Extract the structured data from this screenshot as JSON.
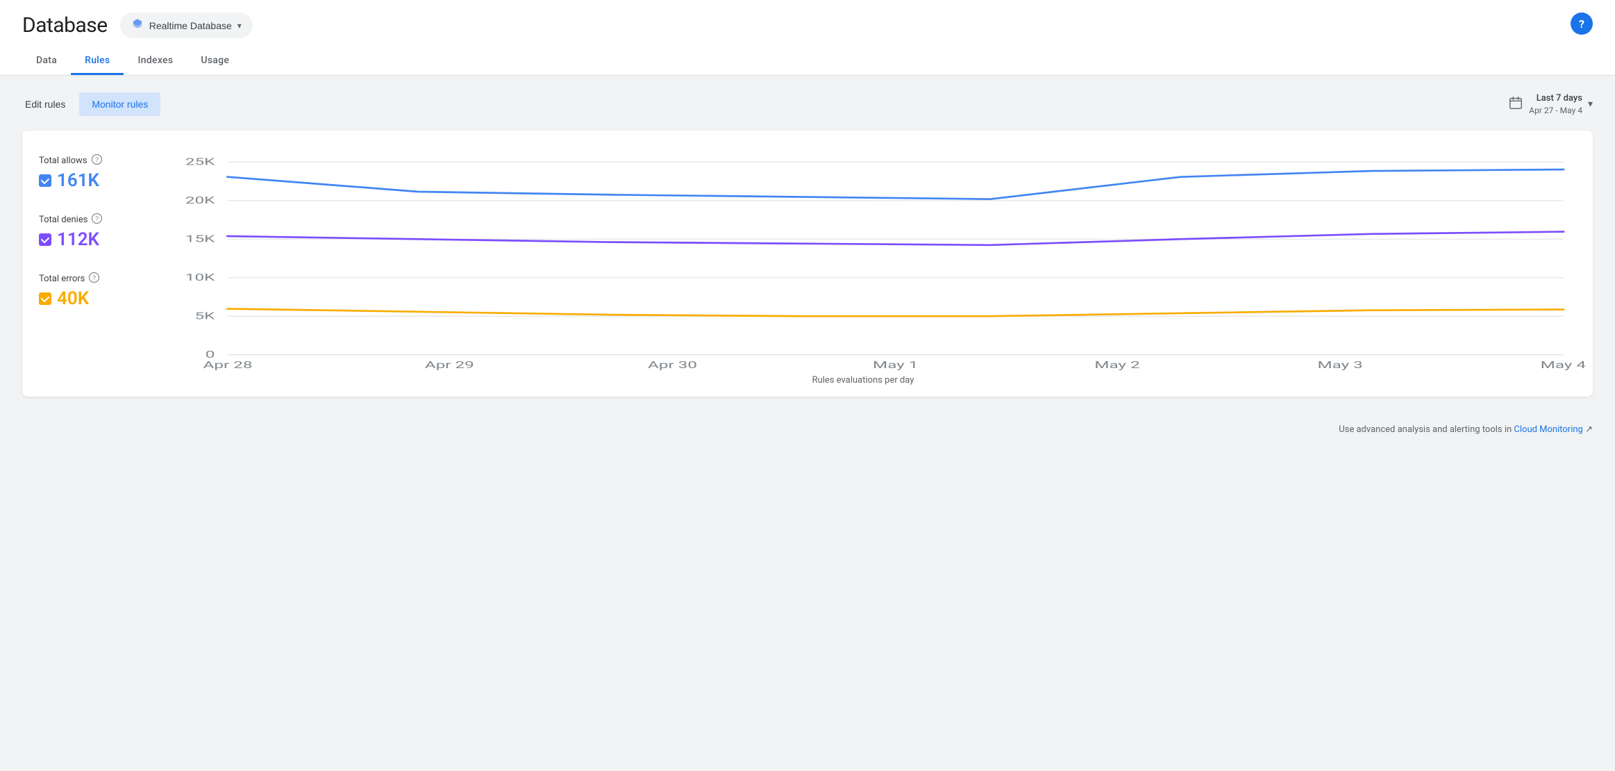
{
  "header": {
    "title": "Database",
    "db_selector_label": "Realtime Database",
    "help_label": "?"
  },
  "nav": {
    "tabs": [
      {
        "id": "data",
        "label": "Data",
        "active": false
      },
      {
        "id": "rules",
        "label": "Rules",
        "active": true
      },
      {
        "id": "indexes",
        "label": "Indexes",
        "active": false
      },
      {
        "id": "usage",
        "label": "Usage",
        "active": false
      }
    ]
  },
  "toolbar": {
    "edit_rules_label": "Edit rules",
    "monitor_rules_label": "Monitor rules",
    "date_period_label": "Last 7 days",
    "date_range_label": "Apr 27 - May 4"
  },
  "chart": {
    "title": "Rules evaluations per day",
    "y_labels": [
      "0",
      "5K",
      "10K",
      "15K",
      "20K",
      "25K"
    ],
    "x_labels": [
      "Apr 28",
      "Apr 29",
      "Apr 30",
      "May 1",
      "May 2",
      "May 3",
      "May 4"
    ],
    "series": [
      {
        "id": "allows",
        "label": "Total allows",
        "value": "161K",
        "color": "#4285f4",
        "checkbox_color": "#4285f4",
        "points": [
          24000,
          22000,
          21500,
          21200,
          21000,
          24000,
          24800,
          25000
        ]
      },
      {
        "id": "denies",
        "label": "Total denies",
        "value": "112K",
        "color": "#7c4dff",
        "checkbox_color": "#7c4dff",
        "points": [
          16000,
          15500,
          15200,
          15000,
          14800,
          15500,
          16200,
          16500
        ]
      },
      {
        "id": "errors",
        "label": "Total errors",
        "value": "40K",
        "color": "#f9ab00",
        "checkbox_color": "#f9ab00",
        "points": [
          6200,
          5800,
          5500,
          5300,
          5300,
          5700,
          6000,
          6100
        ]
      }
    ],
    "y_max": 26000,
    "y_min": 0
  },
  "footer": {
    "note": "Use advanced analysis and alerting tools in",
    "link_label": "Cloud Monitoring",
    "ext_icon": "↗"
  }
}
